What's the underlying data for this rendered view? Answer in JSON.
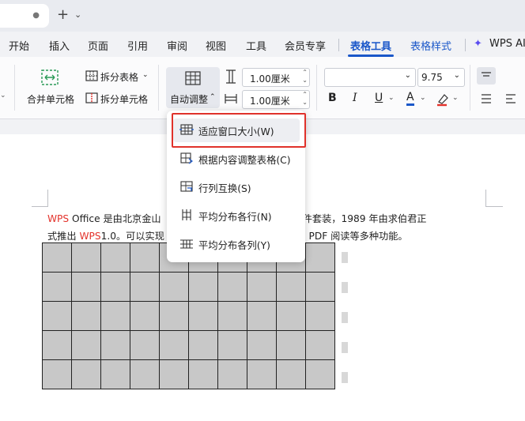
{
  "tab_bar": {
    "doc_tab_dot": "●",
    "new_tab": "+",
    "dropdown": "⌄"
  },
  "menu": {
    "items": [
      "开始",
      "插入",
      "页面",
      "引用",
      "审阅",
      "视图",
      "工具",
      "会员专享",
      "表格工具",
      "表格样式",
      "WPS AI"
    ],
    "active": "表格工具"
  },
  "ribbon": {
    "merge_cells": "合并单元格",
    "split_table": "拆分表格",
    "split_cells": "拆分单元格",
    "auto_adjust": "自动调整",
    "row_height": "1.00厘米",
    "col_width": "1.00厘米",
    "font_name": "",
    "font_size": "9.75",
    "bold": "B",
    "italic": "I",
    "underline": "U",
    "font_color": "A",
    "icons": [
      "merge-cells-icon",
      "split-table-icon",
      "split-cells-icon",
      "auto-adjust-icon",
      "row-height-icon",
      "col-width-icon",
      "highlighter-icon",
      "align-top-icon",
      "align-justify-icon"
    ]
  },
  "document": {
    "line1_prefix": "WPS",
    "line1_a": " Office 是由北京金山",
    "line1_b": "的一款办公软件套装，1989 年由求伯君正",
    "line2_a": "式推出 ",
    "line2_wps": "WPS",
    "line2_b": "1.0。可以实现",
    "line2_c": "演示，PDF 阅读等多种功能。",
    "table_rows": 5,
    "table_cols": 10
  },
  "autofit_menu": {
    "items": [
      {
        "label": "适应窗口大小(W)",
        "icon": "fit-window-icon"
      },
      {
        "label": "根据内容调整表格(C)",
        "icon": "fit-content-icon"
      },
      {
        "label": "行列互换(S)",
        "icon": "swap-rows-cols-icon"
      },
      {
        "label": "平均分布各行(N)",
        "icon": "distribute-rows-icon"
      },
      {
        "label": "平均分布各列(Y)",
        "icon": "distribute-cols-icon"
      }
    ]
  },
  "colors": {
    "accent": "#1a57c9",
    "highlight_border": "#e0312a",
    "red_text": "#e3322b",
    "table_fill": "#c8c8c8"
  }
}
